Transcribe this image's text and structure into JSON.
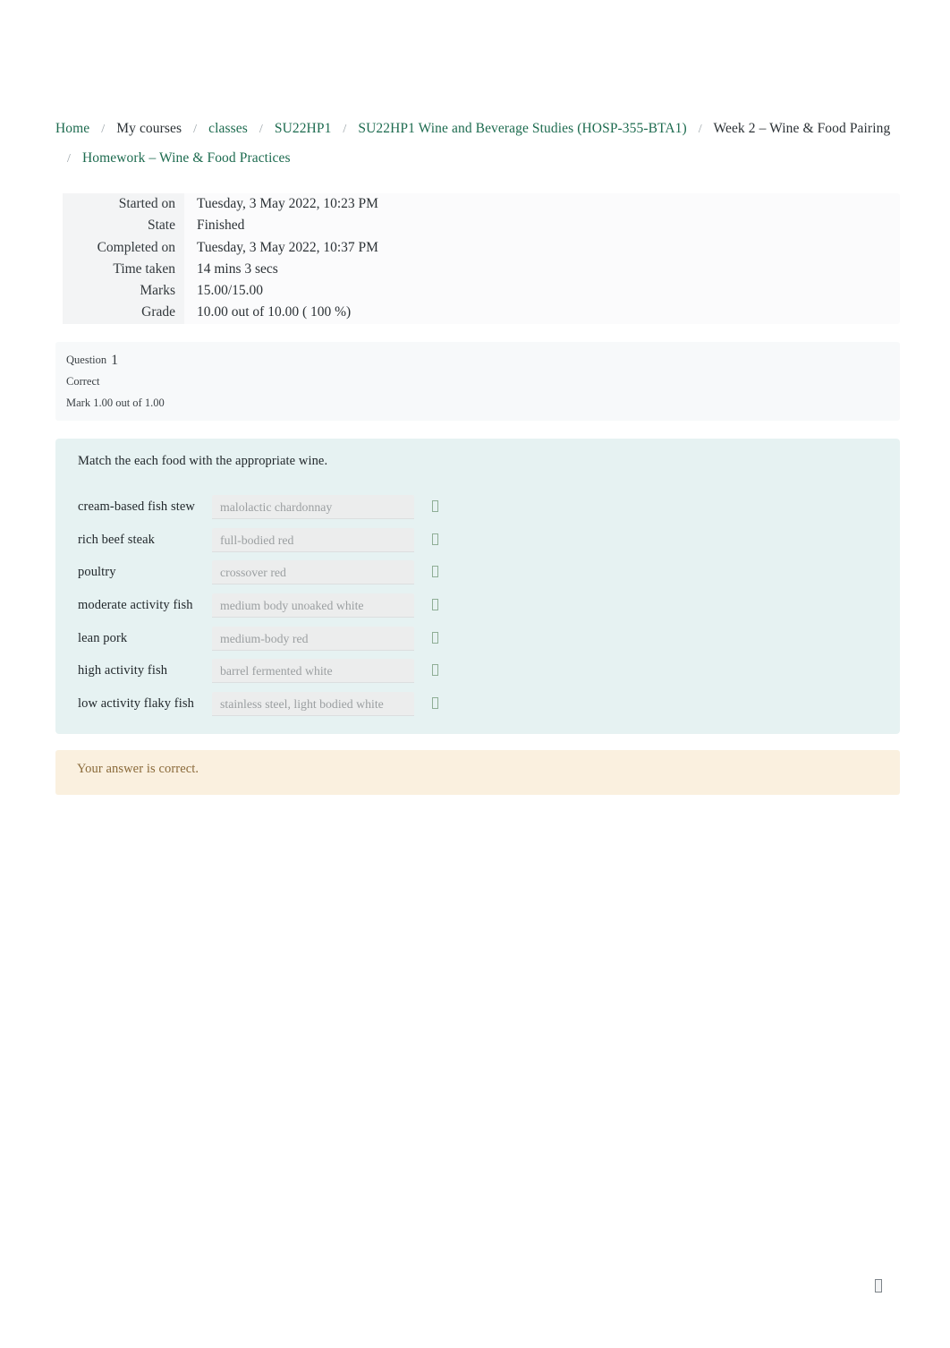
{
  "breadcrumb": {
    "separator": "/",
    "line1": [
      {
        "label": "Home",
        "link": true
      },
      {
        "label": "My courses",
        "link": false
      },
      {
        "label": "classes",
        "link": true
      },
      {
        "label": "SU22HP1",
        "link": true
      },
      {
        "label": "SU22HP1 Wine and Beverage Studies (HOSP-355-BTA1)",
        "link": true
      },
      {
        "label": "Week 2 – Wine & Food Pairing",
        "link": false
      }
    ],
    "line2": [
      {
        "label": "Homework – Wine & Food Practices",
        "link": true
      }
    ]
  },
  "quiz_info": {
    "rows": [
      {
        "label": "Started on",
        "value": "Tuesday, 3 May 2022, 10:23 PM"
      },
      {
        "label": "State",
        "value": "Finished"
      },
      {
        "label": "Completed on",
        "value": "Tuesday, 3 May 2022, 10:37 PM"
      },
      {
        "label": "Time taken",
        "value": "14 mins 3 secs"
      },
      {
        "label": "Marks",
        "value": "15.00/15.00"
      },
      {
        "label": "Grade",
        "value": "10.00   out of 10.00 (  100 %)"
      }
    ]
  },
  "question": {
    "number_label": "Question",
    "number": "1",
    "state": "Correct",
    "mark": "Mark 1.00 out of 1.00",
    "prompt": "Match the each food with the appropriate wine.",
    "caret_icon": "chevron-down-icon",
    "matches": [
      {
        "food": "cream-based fish stew",
        "answer": "malolactic chardonnay"
      },
      {
        "food": "rich beef steak",
        "answer": "full-bodied red"
      },
      {
        "food": "poultry",
        "answer": "crossover red"
      },
      {
        "food": "moderate activity fish",
        "answer": "medium body unoaked white"
      },
      {
        "food": "lean pork",
        "answer": "medium-body red"
      },
      {
        "food": "high activity fish",
        "answer": "barrel fermented white"
      },
      {
        "food": "low activity flaky fish",
        "answer": "stainless steel, light bodied white"
      }
    ]
  },
  "feedback": {
    "text": "Your answer is correct."
  },
  "bottom": {
    "icon": "missing-glyph-icon"
  },
  "colors": {
    "link_green": "#1d6b4f",
    "question_body_bg": "#e6f2f2",
    "feedback_bg": "#faf0df",
    "feedback_text": "#8a6a3a",
    "info_label_bg": "#f3f4f5",
    "caret_green": "#8fae96"
  }
}
